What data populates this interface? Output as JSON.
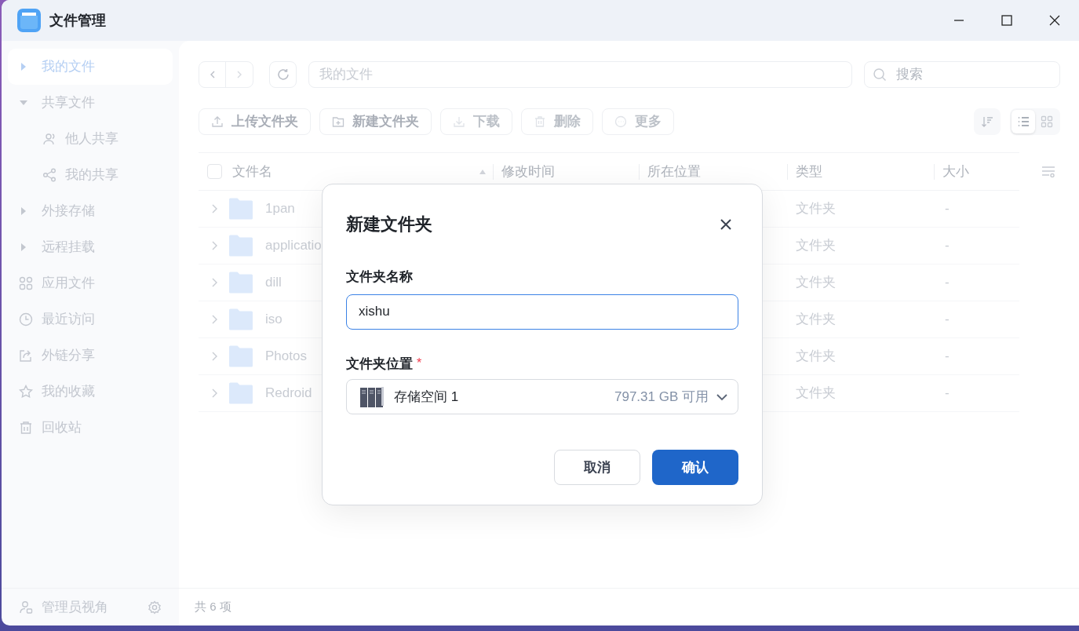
{
  "window": {
    "title": "文件管理"
  },
  "sidebar": {
    "items": [
      {
        "kind": "group",
        "label": "我的文件",
        "selected": true,
        "expanded": false
      },
      {
        "kind": "group",
        "label": "共享文件",
        "selected": false,
        "expanded": true,
        "children": [
          {
            "kind": "people",
            "label": "他人共享",
            "selected": false
          },
          {
            "kind": "share",
            "label": "我的共享",
            "selected": false
          }
        ]
      },
      {
        "kind": "group",
        "label": "外接存储",
        "selected": false,
        "expanded": false
      },
      {
        "kind": "group",
        "label": "远程挂载",
        "selected": false,
        "expanded": false
      },
      {
        "kind": "apps",
        "label": "应用文件",
        "selected": false
      },
      {
        "kind": "clock",
        "label": "最近访问",
        "selected": false
      },
      {
        "kind": "link",
        "label": "外链分享",
        "selected": false
      },
      {
        "kind": "star",
        "label": "我的收藏",
        "selected": false
      },
      {
        "kind": "trash",
        "label": "回收站",
        "selected": false
      }
    ],
    "footer": {
      "label": "管理员视角"
    }
  },
  "toolbar": {
    "path": "我的文件",
    "search": {
      "placeholder": "搜索"
    },
    "actions": [
      {
        "kind": "upload",
        "label": "上传文件夹",
        "disabled": false
      },
      {
        "kind": "new",
        "label": "新建文件夹",
        "disabled": false
      },
      {
        "kind": "download",
        "label": "下载",
        "disabled": true
      },
      {
        "kind": "delete",
        "label": "删除",
        "disabled": true
      },
      {
        "kind": "more",
        "label": "更多",
        "disabled": true
      }
    ],
    "views": [
      {
        "kind": "list",
        "selected": true
      },
      {
        "kind": "grid",
        "selected": false
      }
    ]
  },
  "table": {
    "select_all": {
      "checked": false
    },
    "columns": [
      "文件名",
      "修改时间",
      "所在位置",
      "类型",
      "大小"
    ],
    "rows": [
      {
        "name": "1pan",
        "type": "文件夹",
        "size": "-"
      },
      {
        "name": "applicatio",
        "type": "文件夹",
        "size": "-"
      },
      {
        "name": "dill",
        "type": "文件夹",
        "size": "-"
      },
      {
        "name": "iso",
        "type": "文件夹",
        "size": "-"
      },
      {
        "name": "Photos",
        "type": "文件夹",
        "size": "-"
      },
      {
        "name": "Redroid",
        "type": "文件夹",
        "size": "-"
      }
    ]
  },
  "status_bar": "共 6 项",
  "dialog": {
    "title": "新建文件夹",
    "name_field": {
      "label": "文件夹名称",
      "value": "xishu",
      "focused": true
    },
    "location_field": {
      "label": "文件夹位置",
      "required": true,
      "required_mark": "*",
      "value": "存储空间 1",
      "hint": "797.31 GB 可用"
    },
    "buttons": [
      {
        "kind": "secondary",
        "label": "取消"
      },
      {
        "kind": "primary",
        "label": "确认"
      }
    ]
  }
}
